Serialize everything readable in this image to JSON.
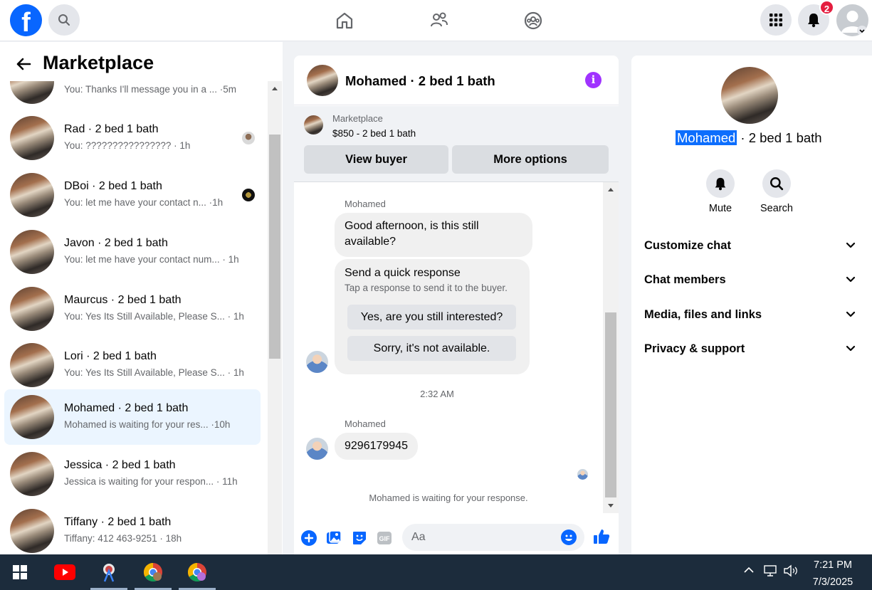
{
  "topbar": {
    "logo": "f",
    "icons": [
      "search-icon",
      "home-icon",
      "friends-icon",
      "groups-icon",
      "menu-grid-icon",
      "bell-icon",
      "profile-avatar"
    ],
    "notification_count": "2"
  },
  "sidebar": {
    "title": "Marketplace",
    "conversations": [
      {
        "name": "",
        "preview": "You: Thanks I'll message you in a ... ·5m"
      },
      {
        "name": "Rad · 2 bed 1 bath",
        "preview": "You: ???????????????? · 1h"
      },
      {
        "name": "DBoi · 2 bed 1 bath",
        "preview": "You: let me have your contact n... ·1h"
      },
      {
        "name": "Javon · 2 bed 1 bath",
        "preview": "You: let me have your contact num... · 1h"
      },
      {
        "name": "Maurcus · 2 bed 1 bath",
        "preview": "You: Yes Its Still Available, Please S... · 1h"
      },
      {
        "name": "Lori · 2 bed 1 bath",
        "preview": "You: Yes Its Still Available, Please S... · 1h"
      },
      {
        "name": "Mohamed · 2 bed 1 bath",
        "preview": "Mohamed is waiting for your res... ·10h"
      },
      {
        "name": "Jessica · 2 bed 1 bath",
        "preview": "Jessica is waiting for your respon... · 11h"
      },
      {
        "name": "Tiffany · 2 bed 1 bath",
        "preview": "Tiffany: 412 463-9251 · 18h"
      }
    ]
  },
  "chat": {
    "title": "Mohamed · 2 bed 1 bath",
    "marketplace_label": "Marketplace",
    "listing": "$850 - 2 bed 1 bath",
    "view_buyer": "View buyer",
    "more_options": "More options",
    "sender1": "Mohamed",
    "message1": "Good afternoon, is this still available?",
    "quick_title": "Send a quick response",
    "quick_sub": "Tap a response to send it to the buyer.",
    "quick_yes": "Yes, are you still interested?",
    "quick_no": "Sorry, it's not available.",
    "time": "2:32 AM",
    "sender2": "Mohamed",
    "message2": "9296179945",
    "waiting": "Mohamed is waiting for your response.",
    "composer_placeholder": "Aa"
  },
  "details": {
    "name_highlight": "Mohamed",
    "name_rest": " · 2 bed 1 bath",
    "mute": "Mute",
    "search": "Search",
    "sections": [
      "Customize chat",
      "Chat members",
      "Media, files and links",
      "Privacy & support"
    ]
  },
  "taskbar": {
    "time": "7:21 PM",
    "date": "7/3/2025"
  },
  "colors": {
    "brand": "#0866ff",
    "badge": "#e41e3f",
    "info": "#a033ff",
    "active_row": "#ebf5ff",
    "taskbar": "#1c2c3c"
  }
}
